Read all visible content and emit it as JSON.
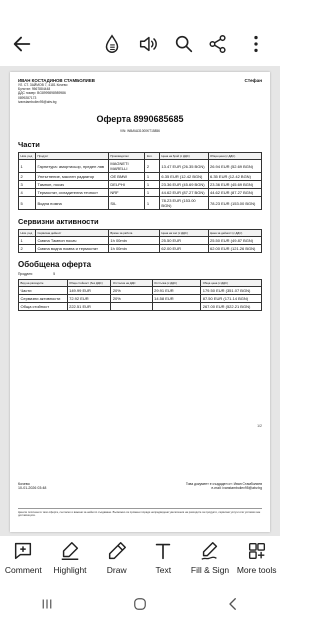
{
  "toolbar": {
    "back_icon": "arrow-left-icon",
    "icons": [
      "accessibility-icon",
      "read-aloud-icon",
      "search-icon",
      "share-icon",
      "more-vertical-icon"
    ]
  },
  "document": {
    "header": {
      "company": "ИВАН КОСТАДИНОВ СТАМБОЛИЕВ",
      "address": "УЛ. СТ. ЗАЙМОВ 7, 4181 Кочево",
      "eik": "Булстат: 9567884448",
      "vat": "ДДС номер: BG8999898989986",
      "phone": "0899287173",
      "email": "ivanstamboliev95@abv.bg",
      "right_name": "Стефан"
    },
    "offer_title": "Оферта 8990685685",
    "vin": "VIN: WBAVA31000KT15856",
    "parts": {
      "title": "Части",
      "headers": [
        "Ном. ред",
        "Продукт",
        "Производител",
        "Кол.",
        "Цена на брой (с ДДС)",
        "Обща цена (с ДДС)"
      ],
      "rows": [
        [
          "1",
          "Гарнитура: амортисьор, преден ляв",
          "MAGNETI MARELLI",
          "2",
          "13.47 EUR (26.35 BGN)",
          "26.94 EUR (52.69 BGN)"
        ],
        [
          "2",
          "Уплътнение, маслен радиатор",
          "OE BMW",
          "1",
          "6.35 EUR (12.42 BGN)",
          "6.35 EUR (12.42 BGN)"
        ],
        [
          "3",
          "Тампон, носач",
          "DELPHI",
          "1",
          "23.36 EUR (45.69 BGN)",
          "23.36 EUR (45.69 BGN)"
        ],
        [
          "4",
          "Термостат, охладителна течност",
          "NRF",
          "1",
          "44.62 EUR (87.27 BGN)",
          "44.62 EUR (87.27 BGN)"
        ],
        [
          "5",
          "Водна помпа",
          "SIL",
          "1",
          "78.23 EUR (153.00 BGN)",
          "78.23 EUR (153.00 BGN)"
        ]
      ]
    },
    "services": {
      "title": "Сервизни активности",
      "headers": [
        "Ном. ред",
        "Сервизна дейност",
        "Време за работа",
        "Цена на час (с ДДС)",
        "Цена за дейност (с ДДС)"
      ],
      "rows": [
        [
          "1",
          "Смяна Тампон носач",
          "1h 00min",
          "25.50 EUR",
          "25.50 EUR (49.87 BGN)"
        ],
        [
          "2",
          "Смяна водна помпа и термостат",
          "1h 00min",
          "62.00 EUR",
          "62.00 EUR (121.26 BGN)"
        ]
      ]
    },
    "summary": {
      "title": "Обобщена оферта",
      "products_label": "Продукти",
      "products_value": "5",
      "headers": [
        "Вид на разходите",
        "Обща стойност (без ДДС)",
        "Отстъпка на ДДС",
        "Отстъпка (с ДДС)",
        "Обща цена (с ДДС)"
      ],
      "rows": [
        [
          "Части",
          "149.99 EUR",
          "20%",
          "29.91 EUR",
          "179.50 EUR (351.07 BGN)"
        ],
        [
          "Сервизни активности",
          "72.92 EUR",
          "20%",
          "14.58 EUR",
          "87.50 EUR (171.14 BGN)"
        ],
        [
          "Обща стойност",
          "222.51 EUR",
          "",
          "",
          "267.00 EUR (522.21 BGN)"
        ]
      ]
    },
    "page_number": "1/2",
    "footer": {
      "city": "Кочево",
      "date": "10-01-2026 03:48",
      "prepared_by": "Това документ е създаден от: Иван Стамболиев",
      "prepared_email": "e-mail: ivanstamboliev95@abv.bg",
      "disclaimer": "Цените посочени в тази оферта, съгласно и важени за нейното създаване. Възможно са промени поради непредвидени увеличения на разходите за продукти, сервизни услуги или условия към доставчиците."
    }
  },
  "bottom_tools": [
    {
      "label": "Comment",
      "icon": "comment-add-icon"
    },
    {
      "label": "Highlight",
      "icon": "highlight-icon"
    },
    {
      "label": "Draw",
      "icon": "pen-icon"
    },
    {
      "label": "Text",
      "icon": "text-icon"
    },
    {
      "label": "Fill & Sign",
      "icon": "fill-sign-icon"
    },
    {
      "label": "More tools",
      "icon": "more-tools-icon"
    }
  ],
  "navbar": [
    "recent-apps-icon",
    "home-icon",
    "back-icon"
  ]
}
